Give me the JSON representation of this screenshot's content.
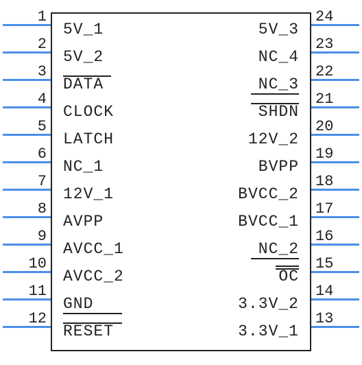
{
  "chip": {
    "left_pins": [
      {
        "num": "1",
        "label": "5V_1"
      },
      {
        "num": "2",
        "label": "5V_2"
      },
      {
        "num": "3",
        "label": "DATA"
      },
      {
        "num": "4",
        "label": "CLOCK"
      },
      {
        "num": "5",
        "label": "LATCH"
      },
      {
        "num": "6",
        "label": "NC_1"
      },
      {
        "num": "7",
        "label": "12V_1"
      },
      {
        "num": "8",
        "label": "AVPP"
      },
      {
        "num": "9",
        "label": "AVCC_1"
      },
      {
        "num": "10",
        "label": "AVCC_2"
      },
      {
        "num": "11",
        "label": "GND"
      },
      {
        "num": "12",
        "label": "RESET"
      }
    ],
    "right_pins": [
      {
        "num": "24",
        "label": "5V_3"
      },
      {
        "num": "23",
        "label": "NC_4"
      },
      {
        "num": "22",
        "label": "NC_3"
      },
      {
        "num": "21",
        "label": "SHDN"
      },
      {
        "num": "20",
        "label": "12V_2"
      },
      {
        "num": "19",
        "label": "BVPP"
      },
      {
        "num": "18",
        "label": "BVCC_2"
      },
      {
        "num": "17",
        "label": "BVCC_1"
      },
      {
        "num": "16",
        "label": "NC_2"
      },
      {
        "num": "15",
        "label": "OC"
      },
      {
        "num": "14",
        "label": "3.3V_2"
      },
      {
        "num": "13",
        "label": "3.3V_1"
      }
    ]
  }
}
